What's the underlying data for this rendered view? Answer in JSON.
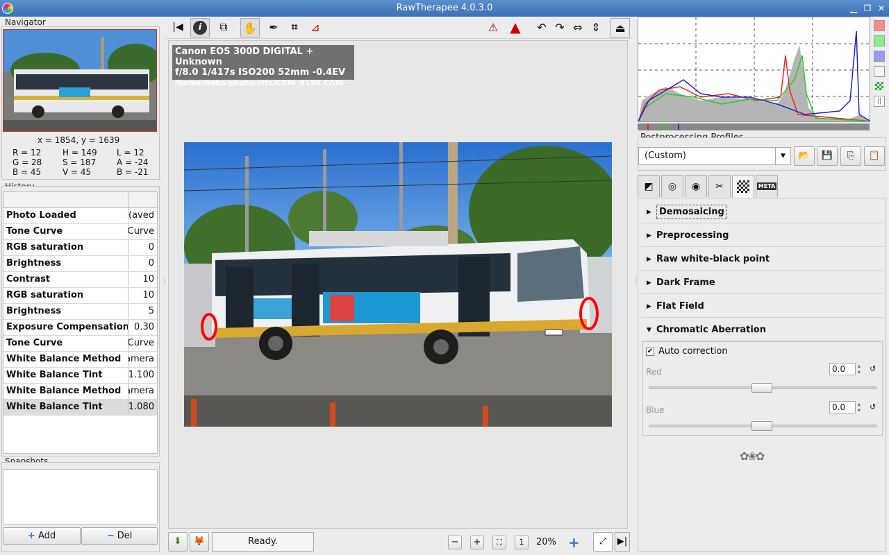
{
  "window": {
    "title": "RawTherapee 4.0.3.0"
  },
  "navigator": {
    "title": "Navigator",
    "coords": "x = 1854, y = 1639",
    "rgb": [
      "R = 12",
      "G = 28",
      "B = 45"
    ],
    "hsv": [
      "H = 149",
      "S = 187",
      "V = 45"
    ],
    "lab": [
      "L = 12",
      "A = -24",
      "B = -21"
    ]
  },
  "history": {
    "title": "History",
    "rows": [
      {
        "label": "Photo Loaded",
        "value": "aved)"
      },
      {
        "label": "Tone Curve",
        "value": "Curve"
      },
      {
        "label": "RGB saturation",
        "value": "0"
      },
      {
        "label": "Brightness",
        "value": "0"
      },
      {
        "label": "Contrast",
        "value": "10"
      },
      {
        "label": "RGB saturation",
        "value": "10"
      },
      {
        "label": "Brightness",
        "value": "5"
      },
      {
        "label": "Exposure Compensation",
        "value": "0.30"
      },
      {
        "label": "Tone Curve",
        "value": "Curve"
      },
      {
        "label": "White Balance Method",
        "value": "amera"
      },
      {
        "label": "White Balance Tint",
        "value": "1.100"
      },
      {
        "label": "White Balance Method",
        "value": "amera"
      },
      {
        "label": "White Balance Tint",
        "value": "1.080"
      }
    ]
  },
  "snapshots": {
    "title": "Snapshots",
    "add_label": "Add",
    "del_label": "Del"
  },
  "image_info": {
    "camera": "Canon EOS 300D DIGITAL + Unknown",
    "exposure": "f/8.0  1/417s  ISO200  52mm  -0.4EV",
    "path": "/home/buba/photo/stts/CRW_9159.CRW"
  },
  "status": {
    "text": "Ready.",
    "zoom": "20%"
  },
  "profiles": {
    "title": "Postprocessing Profiles",
    "selected": "(Custom)"
  },
  "sections": [
    {
      "label": "Demosaicing",
      "expanded": false
    },
    {
      "label": "Preprocessing",
      "expanded": false
    },
    {
      "label": "Raw white-black point",
      "expanded": false
    },
    {
      "label": "Dark Frame",
      "expanded": false
    },
    {
      "label": "Flat Field",
      "expanded": false
    },
    {
      "label": "Chromatic Aberration",
      "expanded": true
    }
  ],
  "chromatic": {
    "auto_label": "Auto correction",
    "auto_checked": true,
    "red_label": "Red",
    "red_value": "0.0",
    "blue_label": "Blue",
    "blue_value": "0.0"
  },
  "tabs": [
    "exposure-icon",
    "detail-icon",
    "color-icon",
    "transform-icon",
    "raw-icon",
    "metadata-icon"
  ],
  "tab_meta_label": "META",
  "colors": {
    "accent": "#3c6fb4",
    "annotation": "#ff0000"
  }
}
